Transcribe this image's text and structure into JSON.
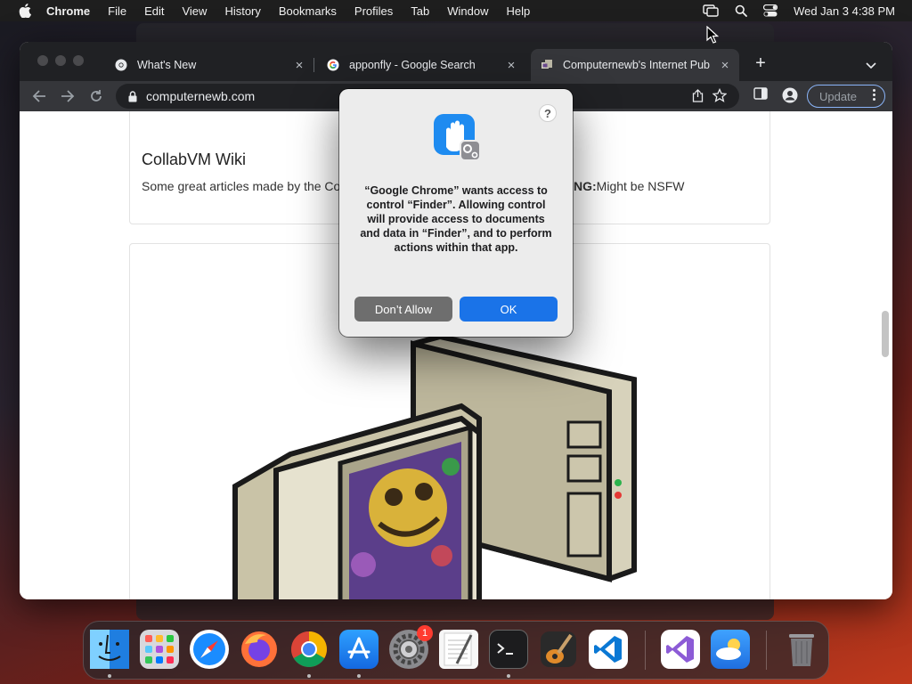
{
  "menubar": {
    "app_name": "Chrome",
    "items": [
      "File",
      "Edit",
      "View",
      "History",
      "Bookmarks",
      "Profiles",
      "Tab",
      "Window",
      "Help"
    ],
    "clock": "Wed Jan 3  4:38 PM"
  },
  "tabs": [
    {
      "title": "What's New",
      "icon": "chrome-icon",
      "active": false
    },
    {
      "title": "apponfly - Google Search",
      "icon": "google-icon",
      "active": false
    },
    {
      "title": "Computernewb's Internet Pub",
      "icon": "computernewb-icon",
      "active": true
    }
  ],
  "toolbar": {
    "url": "computernewb.com",
    "update_label": "Update"
  },
  "page": {
    "section_title": "CollabVM Wiki",
    "section_text": "Some great articles made by the Co",
    "warning_label": "NG:",
    "warning_text": "Might be NSFW"
  },
  "dialog": {
    "help_label": "?",
    "message": "“Google Chrome” wants access to control “Finder”. Allowing control will provide access to documents and data in “Finder”, and to perform actions within that app.",
    "deny_label": "Don’t Allow",
    "ok_label": "OK",
    "icon": "privacy-hand-icon"
  },
  "dock": {
    "apps": [
      "Finder",
      "Launchpad",
      "Safari",
      "Firefox",
      "Google Chrome",
      "App Store",
      "System Settings",
      "TextEdit",
      "Terminal",
      "GarageBand",
      "Visual Studio Code",
      "Visual Studio",
      "Weather",
      "Trash"
    ],
    "settings_badge": "1"
  },
  "colors": {
    "accent": "#1a73e8",
    "tabstrip": "#202124",
    "toolbar": "#35363a"
  }
}
